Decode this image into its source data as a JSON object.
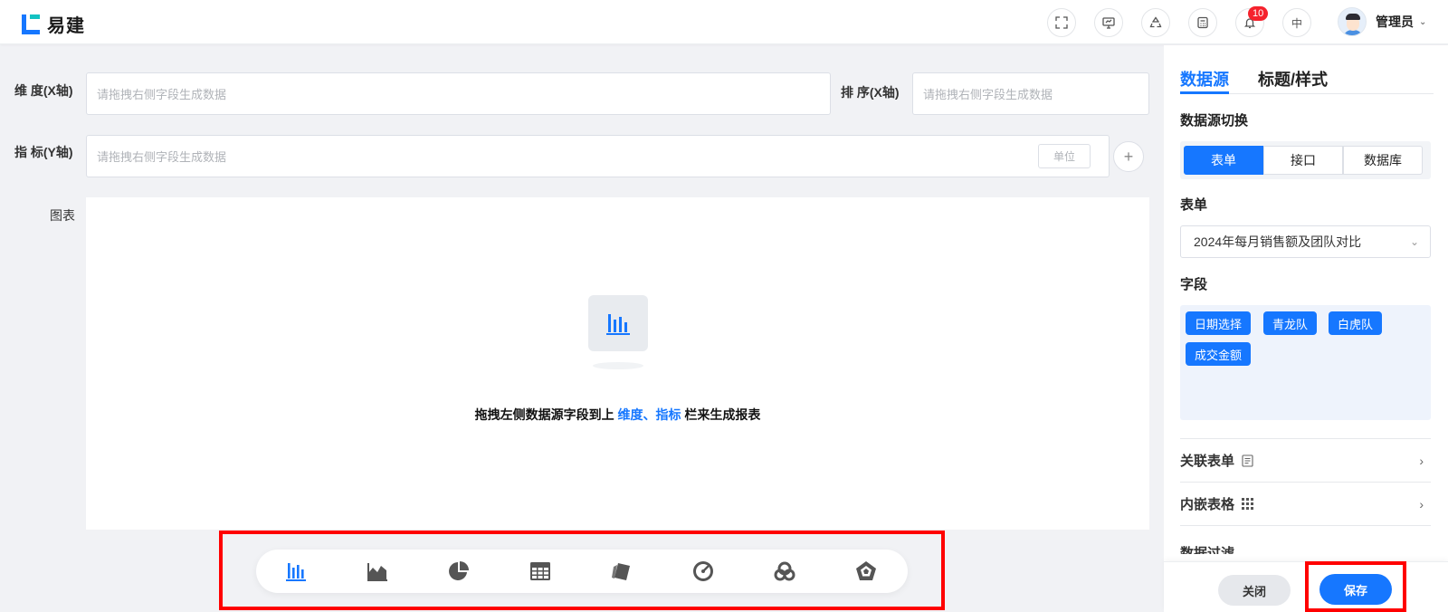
{
  "header": {
    "app_name": "易建",
    "lang_label": "中",
    "notification_count": "10",
    "user_name": "管理员",
    "icons": [
      "fullscreen-icon",
      "screen-icon",
      "recycle-icon",
      "calculator-icon",
      "bell-icon"
    ]
  },
  "form": {
    "dimension_label": "维 度(X轴)",
    "dimension_placeholder": "请拖拽右侧字段生成数据",
    "sort_label": "排 序(X轴)",
    "sort_placeholder": "请拖拽右侧字段生成数据",
    "metric_label": "指 标(Y轴)",
    "metric_placeholder": "请拖拽右侧字段生成数据",
    "unit_label": "单位",
    "chart_label": "图表"
  },
  "empty_state": {
    "text_before": "拖拽左侧数据源字段到上 ",
    "highlight": "维度、指标",
    "text_after": " 栏来生成报表"
  },
  "chart_types": [
    "bar-chart-icon",
    "area-chart-icon",
    "pie-chart-icon",
    "table-icon",
    "card-icon",
    "gauge-icon",
    "ring-icon",
    "radar-icon"
  ],
  "right_panel": {
    "tabs": [
      {
        "label": "数据源",
        "active": true
      },
      {
        "label": "标题/样式",
        "active": false
      }
    ],
    "source_switch_title": "数据源切换",
    "source_options": [
      {
        "label": "表单",
        "active": true
      },
      {
        "label": "接口",
        "active": false
      },
      {
        "label": "数据库",
        "active": false
      }
    ],
    "form_title": "表单",
    "form_selected": "2024年每月销售额及团队对比",
    "fields_title": "字段",
    "fields": [
      "日期选择",
      "青龙队",
      "白虎队",
      "成交金额"
    ],
    "linked_form": "关联表单",
    "embedded_table": "内嵌表格",
    "data_filter": "数据过滤"
  },
  "footer": {
    "close_label": "关闭",
    "save_label": "保存"
  },
  "colors": {
    "primary": "#1677ff",
    "highlight_border": "#ff0000"
  }
}
